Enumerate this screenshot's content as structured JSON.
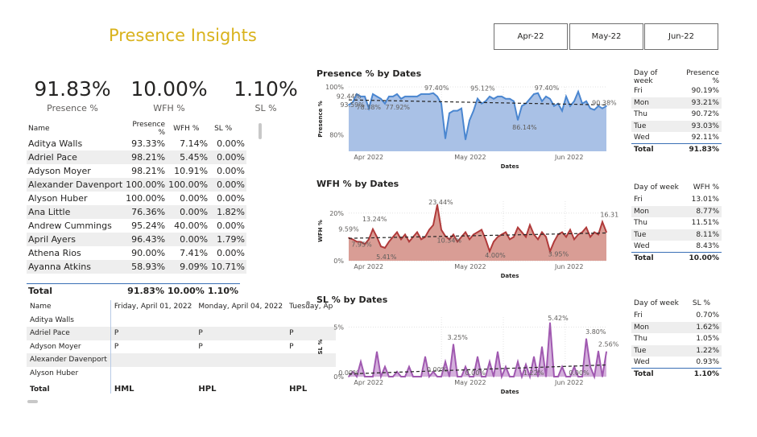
{
  "title": "Presence Insights",
  "slicers": [
    "Apr-22",
    "May-22",
    "Jun-22"
  ],
  "kpis": [
    {
      "value": "91.83%",
      "label": "Presence %"
    },
    {
      "value": "10.00%",
      "label": "WFH %"
    },
    {
      "value": "1.10%",
      "label": "SL %"
    }
  ],
  "employee_table": {
    "headers": [
      "Name",
      "Presence %",
      "WFH %",
      "SL %"
    ],
    "rows": [
      [
        "Aditya Walls",
        "93.33%",
        "7.14%",
        "0.00%"
      ],
      [
        "Adriel Pace",
        "98.21%",
        "5.45%",
        "0.00%"
      ],
      [
        "Adyson Moyer",
        "98.21%",
        "10.91%",
        "0.00%"
      ],
      [
        "Alexander Davenport",
        "100.00%",
        "100.00%",
        "0.00%"
      ],
      [
        "Alyson Huber",
        "100.00%",
        "0.00%",
        "0.00%"
      ],
      [
        "Ana Little",
        "76.36%",
        "0.00%",
        "1.82%"
      ],
      [
        "Andrew Cummings",
        "95.24%",
        "40.00%",
        "0.00%"
      ],
      [
        "April Ayers",
        "96.43%",
        "0.00%",
        "1.79%"
      ],
      [
        "Athena Rios",
        "90.00%",
        "7.41%",
        "0.00%"
      ],
      [
        "Ayanna Atkins",
        "58.93%",
        "9.09%",
        "10.71%"
      ]
    ],
    "total": [
      "Total",
      "91.83%",
      "10.00%",
      "1.10%"
    ]
  },
  "matrix": {
    "headers": [
      "Name",
      "Friday, April 01, 2022",
      "Monday, April 04, 2022",
      "Tuesday, Ap"
    ],
    "rows": [
      [
        "Aditya Walls",
        "",
        "",
        ""
      ],
      [
        "Adriel Pace",
        "P",
        "P",
        "P"
      ],
      [
        "Adyson Moyer",
        "P",
        "P",
        "P"
      ],
      [
        "Alexander Davenport",
        "",
        "",
        ""
      ],
      [
        "Alyson Huber",
        "",
        "",
        ""
      ]
    ],
    "total": [
      "Total",
      "HML",
      "HPL",
      "HPL"
    ]
  },
  "charts": [
    {
      "title": "Presence % by Dates",
      "ylabel": "Presence %",
      "xlabel": "Dates",
      "yticks": [
        "100%",
        "80%"
      ],
      "xticks": [
        "Apr 2022",
        "May 2022",
        "Jun 2022"
      ],
      "color": "#4a86d0",
      "fill": "#a9c1e6",
      "labels": [
        "92.44%",
        "93.59%",
        "97.40%",
        "95.12%",
        "97.40%",
        "90.38%",
        "86.14%",
        "78.38%",
        "77.92%"
      ]
    },
    {
      "title": "WFH % by Dates",
      "ylabel": "WFH %",
      "xlabel": "Dates",
      "yticks": [
        "20%",
        "0%"
      ],
      "xticks": [
        "Apr 2022",
        "May 2022",
        "Jun 2022"
      ],
      "color": "#b03a3a",
      "fill": "#d99d95",
      "labels": [
        "9.59%",
        "13.24%",
        "23.44%",
        "16.31%",
        "7.95%",
        "5.41%",
        "10.34%",
        "4.00%",
        "3.95%"
      ]
    },
    {
      "title": "SL % by Dates",
      "ylabel": "SL %",
      "xlabel": "Dates",
      "yticks": [
        "5%",
        "0%"
      ],
      "xticks": [
        "Apr 2022",
        "May 2022",
        "Jun 2022"
      ],
      "color": "#a059b0",
      "fill": "#d4b0dc",
      "labels": [
        "3.25%",
        "5.42%",
        "3.80%",
        "2.56%",
        "0.00%",
        "0.00%",
        "0.00%",
        "1.22%",
        "0.00%"
      ]
    }
  ],
  "chart_data": [
    {
      "type": "area",
      "title": "Presence % by Dates",
      "xlabel": "Dates",
      "ylabel": "Presence %",
      "x": [
        "2022-04-01",
        "2022-04-04",
        "2022-04-05",
        "2022-04-06",
        "2022-04-07",
        "2022-04-08",
        "2022-04-11",
        "2022-04-12",
        "2022-04-13",
        "2022-04-14",
        "2022-04-15",
        "2022-04-18",
        "2022-04-19",
        "2022-04-20",
        "2022-04-21",
        "2022-04-22",
        "2022-04-25",
        "2022-04-26",
        "2022-04-27",
        "2022-04-28",
        "2022-04-29",
        "2022-05-02",
        "2022-05-03",
        "2022-05-04",
        "2022-05-05",
        "2022-05-06",
        "2022-05-09",
        "2022-05-10",
        "2022-05-11",
        "2022-05-12",
        "2022-05-13",
        "2022-05-16",
        "2022-05-17",
        "2022-05-18",
        "2022-05-19",
        "2022-05-20",
        "2022-05-23",
        "2022-05-24",
        "2022-05-25",
        "2022-05-26",
        "2022-05-27",
        "2022-05-30",
        "2022-05-31",
        "2022-06-01",
        "2022-06-02",
        "2022-06-03",
        "2022-06-06",
        "2022-06-07",
        "2022-06-08",
        "2022-06-09",
        "2022-06-10",
        "2022-06-13",
        "2022-06-14",
        "2022-06-15",
        "2022-06-16",
        "2022-06-17",
        "2022-06-20",
        "2022-06-21",
        "2022-06-22",
        "2022-06-23",
        "2022-06-24",
        "2022-06-27",
        "2022-06-28",
        "2022-06-29",
        "2022-06-30"
      ],
      "values": [
        92.44,
        93.59,
        97,
        96,
        96,
        91,
        97,
        96,
        95,
        93,
        96,
        96,
        97,
        95,
        96,
        96,
        96,
        96,
        97,
        97,
        97,
        97.4,
        96,
        93,
        78.38,
        89,
        90,
        90,
        91,
        77.92,
        86,
        90,
        95.12,
        93,
        94,
        96,
        95,
        96,
        96,
        95,
        95,
        94,
        86.14,
        92,
        93,
        95,
        97,
        97.4,
        94,
        96,
        95,
        92,
        93,
        90,
        96,
        92,
        94,
        98,
        93,
        94,
        91,
        90.38,
        92,
        91,
        92
      ],
      "ylim": [
        73,
        100
      ]
    },
    {
      "type": "area",
      "title": "WFH % by Dates",
      "xlabel": "Dates",
      "ylabel": "WFH %",
      "x": [
        "2022-04-01",
        "2022-04-04",
        "2022-04-05",
        "2022-04-06",
        "2022-04-07",
        "2022-04-08",
        "2022-04-11",
        "2022-04-12",
        "2022-04-13",
        "2022-04-14",
        "2022-04-15",
        "2022-04-18",
        "2022-04-19",
        "2022-04-20",
        "2022-04-21",
        "2022-04-22",
        "2022-04-25",
        "2022-04-26",
        "2022-04-27",
        "2022-04-28",
        "2022-04-29",
        "2022-05-02",
        "2022-05-03",
        "2022-05-04",
        "2022-05-05",
        "2022-05-06",
        "2022-05-09",
        "2022-05-10",
        "2022-05-11",
        "2022-05-12",
        "2022-05-13",
        "2022-05-16",
        "2022-05-17",
        "2022-05-18",
        "2022-05-19",
        "2022-05-20",
        "2022-05-23",
        "2022-05-24",
        "2022-05-25",
        "2022-05-26",
        "2022-05-27",
        "2022-05-30",
        "2022-05-31",
        "2022-06-01",
        "2022-06-02",
        "2022-06-03",
        "2022-06-06",
        "2022-06-07",
        "2022-06-08",
        "2022-06-09",
        "2022-06-10",
        "2022-06-13",
        "2022-06-14",
        "2022-06-15",
        "2022-06-16",
        "2022-06-17",
        "2022-06-20",
        "2022-06-21",
        "2022-06-22",
        "2022-06-23",
        "2022-06-24",
        "2022-06-27",
        "2022-06-28",
        "2022-06-29",
        "2022-06-30"
      ],
      "values": [
        9.59,
        9,
        8,
        7.95,
        7,
        9,
        13.24,
        10,
        6,
        5.41,
        8,
        10,
        12,
        9,
        11,
        8,
        10,
        12,
        9,
        10,
        13,
        15,
        23.44,
        13,
        10.34,
        9,
        11,
        8,
        10,
        12,
        9,
        11,
        12,
        13,
        9,
        4.0,
        8,
        10,
        11,
        12,
        9,
        10,
        14,
        12,
        10,
        15,
        11,
        9,
        12,
        10,
        3.95,
        8,
        11,
        12,
        10,
        13,
        9,
        11,
        12,
        14,
        10,
        12,
        11,
        16.31,
        12
      ],
      "ylim": [
        0,
        25
      ]
    },
    {
      "type": "area",
      "title": "SL % by Dates",
      "xlabel": "Dates",
      "ylabel": "SL %",
      "x": [
        "2022-04-01",
        "2022-04-04",
        "2022-04-05",
        "2022-04-06",
        "2022-04-07",
        "2022-04-08",
        "2022-04-11",
        "2022-04-12",
        "2022-04-13",
        "2022-04-14",
        "2022-04-15",
        "2022-04-18",
        "2022-04-19",
        "2022-04-20",
        "2022-04-21",
        "2022-04-22",
        "2022-04-25",
        "2022-04-26",
        "2022-04-27",
        "2022-04-28",
        "2022-04-29",
        "2022-05-02",
        "2022-05-03",
        "2022-05-04",
        "2022-05-05",
        "2022-05-06",
        "2022-05-09",
        "2022-05-10",
        "2022-05-11",
        "2022-05-12",
        "2022-05-13",
        "2022-05-16",
        "2022-05-17",
        "2022-05-18",
        "2022-05-19",
        "2022-05-20",
        "2022-05-23",
        "2022-05-24",
        "2022-05-25",
        "2022-05-26",
        "2022-05-27",
        "2022-05-30",
        "2022-05-31",
        "2022-06-01",
        "2022-06-02",
        "2022-06-03",
        "2022-06-06",
        "2022-06-07",
        "2022-06-08",
        "2022-06-09",
        "2022-06-10",
        "2022-06-13",
        "2022-06-14",
        "2022-06-15",
        "2022-06-16",
        "2022-06-17",
        "2022-06-20",
        "2022-06-21",
        "2022-06-22",
        "2022-06-23",
        "2022-06-24",
        "2022-06-27",
        "2022-06-28",
        "2022-06-29",
        "2022-06-30"
      ],
      "values": [
        0,
        0.5,
        0,
        1.5,
        0,
        0,
        0,
        2.5,
        0,
        1,
        0,
        0,
        0.5,
        0,
        0,
        1,
        0,
        0,
        0,
        2,
        0,
        0.5,
        0,
        0,
        1.5,
        0,
        3.25,
        0,
        0,
        1,
        0,
        0,
        2,
        0,
        0,
        1.5,
        0,
        2.5,
        0,
        1,
        0,
        0,
        1.5,
        0,
        1.22,
        0,
        2,
        0,
        3,
        0,
        5.42,
        0,
        0,
        1,
        0,
        0,
        1,
        0,
        0,
        3.8,
        1,
        0,
        2.56,
        0,
        2.5
      ],
      "ylim": [
        0,
        6
      ]
    }
  ],
  "dow_tables": [
    {
      "headers": [
        "Day of week",
        "Presence %"
      ],
      "rows": [
        [
          "Fri",
          "90.19%"
        ],
        [
          "Mon",
          "93.21%"
        ],
        [
          "Thu",
          "90.72%"
        ],
        [
          "Tue",
          "93.03%"
        ],
        [
          "Wed",
          "92.11%"
        ]
      ],
      "total": [
        "Total",
        "91.83%"
      ]
    },
    {
      "headers": [
        "Day of week",
        "WFH %"
      ],
      "rows": [
        [
          "Fri",
          "13.01%"
        ],
        [
          "Mon",
          "8.77%"
        ],
        [
          "Thu",
          "11.51%"
        ],
        [
          "Tue",
          "8.11%"
        ],
        [
          "Wed",
          "8.43%"
        ]
      ],
      "total": [
        "Total",
        "10.00%"
      ]
    },
    {
      "headers": [
        "Day of week",
        "SL %"
      ],
      "rows": [
        [
          "Fri",
          "0.70%"
        ],
        [
          "Mon",
          "1.62%"
        ],
        [
          "Thu",
          "1.05%"
        ],
        [
          "Tue",
          "1.22%"
        ],
        [
          "Wed",
          "0.93%"
        ]
      ],
      "total": [
        "Total",
        "1.10%"
      ]
    }
  ]
}
